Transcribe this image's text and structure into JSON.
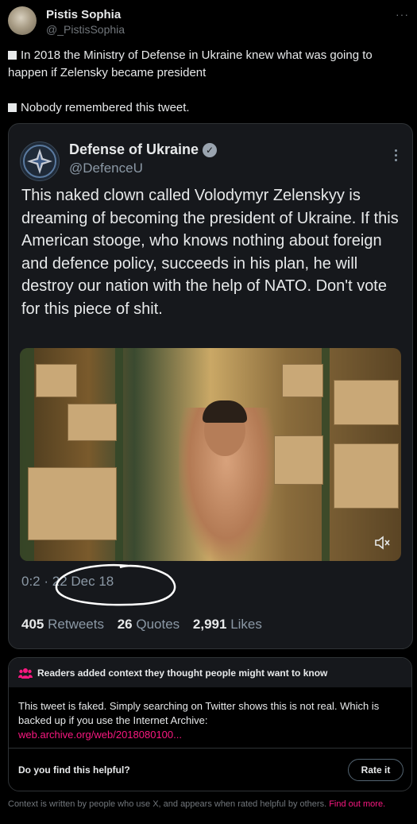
{
  "author": {
    "name": "Pistis Sophia",
    "handle": "@_PistisSophia",
    "more_label": "···"
  },
  "tweet": {
    "lines": [
      "In 2018 the Ministry of Defense in Ukraine knew what was going to happen if Zelensky became president",
      "Nobody remembered this tweet."
    ]
  },
  "embedded": {
    "name": "Defense of Ukraine",
    "verified_mark": "✓",
    "handle": "@DefenceU",
    "text": "This naked clown called Volodymyr Zelenskyy is dreaming of becoming the president of Ukraine. If this American stooge, who knows nothing about foreign and defence policy, succeeds in his plan, he will destroy our nation with the help of NATO. Don't vote for this piece of shit.",
    "video_time": "0:2",
    "date": "· 22 Dec 18",
    "stats": {
      "retweets_value": "405",
      "retweets_label": "Retweets",
      "quotes_value": "26",
      "quotes_label": "Quotes",
      "likes_value": "2,991",
      "likes_label": "Likes"
    }
  },
  "community_note": {
    "title": "Readers added context they thought people might want to know",
    "body": "This tweet is faked. Simply searching on Twitter shows this is not real. Which is backed up if you use the Internet Archive:",
    "link": "web.archive.org/web/2018080100...",
    "question": "Do you find this helpful?",
    "rate_label": "Rate it"
  },
  "footnote": {
    "text": "Context is written by people who use X, and appears when rated helpful by others.",
    "link": "Find out more."
  },
  "colors": {
    "link": "#f91880",
    "note_icon": "#f91880",
    "background": "#000000"
  }
}
